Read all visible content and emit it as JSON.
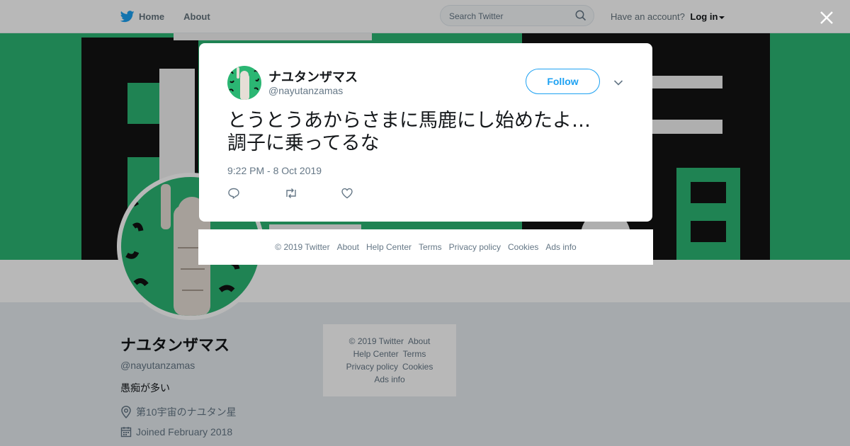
{
  "nav": {
    "home_label": "Home",
    "about_label": "About",
    "search_placeholder": "Search Twitter",
    "have_account": "Have an account?",
    "login_label": "Log in"
  },
  "profile": {
    "name": "ナユタンザマス",
    "handle": "@nayutanzamas",
    "bio": "愚痴が多い",
    "location": "第10宇宙のナユタン星",
    "joined": "Joined February 2018"
  },
  "side_footer": {
    "items": [
      "© 2019 Twitter",
      "About",
      "Help Center",
      "Terms",
      "Privacy policy",
      "Cookies",
      "Ads info"
    ]
  },
  "tweet": {
    "author_name": "ナユタンザマス",
    "author_handle": "@nayutanzamas",
    "follow_label": "Follow",
    "text_line1": "とうとうあからさまに馬鹿にし始めたよ…",
    "text_line2": "調子に乗ってるな",
    "timestamp": "9:22 PM - 8 Oct 2019"
  },
  "modal_footer": {
    "items": [
      "© 2019 Twitter",
      "About",
      "Help Center",
      "Terms",
      "Privacy policy",
      "Cookies",
      "Ads info"
    ]
  },
  "icons": {
    "twitter_bird": "twitter-bird-icon",
    "search": "search-icon",
    "close": "close-icon",
    "chevron": "chevron-down-icon",
    "reply": "reply-icon",
    "retweet": "retweet-icon",
    "like": "heart-icon",
    "location": "location-icon",
    "calendar": "calendar-icon"
  },
  "colors": {
    "brand_blue": "#1da1f2",
    "banner_green": "#2bb673",
    "muted_text": "#657786",
    "background": "#e6ecf0"
  }
}
